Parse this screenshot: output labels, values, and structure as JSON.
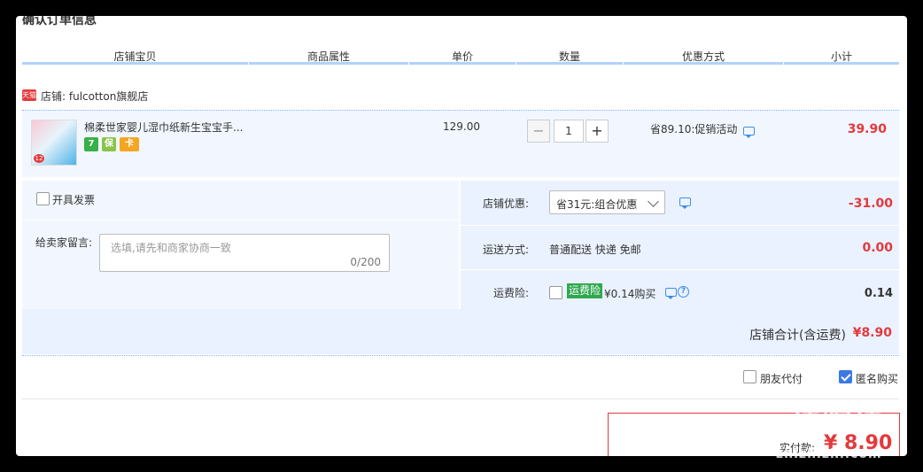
{
  "page_title": "确认订单信息",
  "columns": [
    "店铺宝贝",
    "商品属性",
    "单价",
    "数量",
    "优惠方式",
    "小计"
  ],
  "shop": {
    "badge": "天猫",
    "label": "店铺: fulcotton旗舰店"
  },
  "item": {
    "name": "棉柔世家婴儿湿巾纸新生宝宝手...",
    "thumb_tag": "12",
    "service_icons": [
      "7",
      "保",
      "卡"
    ],
    "price": "129.00",
    "qty_minus": "−",
    "qty": "1",
    "qty_plus": "+",
    "promo": "省89.10:促销活动",
    "subtotal": "39.90"
  },
  "options": {
    "invoice_label": "开具发票",
    "message_label": "给卖家留言:",
    "message_placeholder": "选填,请先和商家协商一致",
    "message_count": "0/200",
    "shop_discount_label": "店铺优惠:",
    "shop_discount_value": "省31元:组合优惠",
    "shop_discount_amount": "-31.00",
    "shipping_label": "运送方式:",
    "shipping_value": "普通配送 快递 免邮",
    "shipping_amount": "0.00",
    "insurance_label": "运费险:",
    "insurance_tag": "运费险",
    "insurance_text": "¥0.14购买",
    "insurance_amount": "0.14",
    "shop_total_label": "店铺合计(含运费)",
    "shop_total_value": "¥8.90"
  },
  "footer": {
    "friend_pay_label": "朋友代付",
    "anonymous_label": "匿名购买",
    "anonymous_checked": true,
    "pay_label": "实付款:",
    "pay_amount": "¥ 8.90"
  },
  "watermark": {
    "main": "值得值",
    "sub": "zhizhizhi.com"
  },
  "colors": {
    "accent_red": "#e4393c",
    "header_line": "#b2d1ff",
    "row_bg": "#f2f7ff",
    "options_bg": "#eaf2ff",
    "link_blue": "#3c8ee6"
  }
}
